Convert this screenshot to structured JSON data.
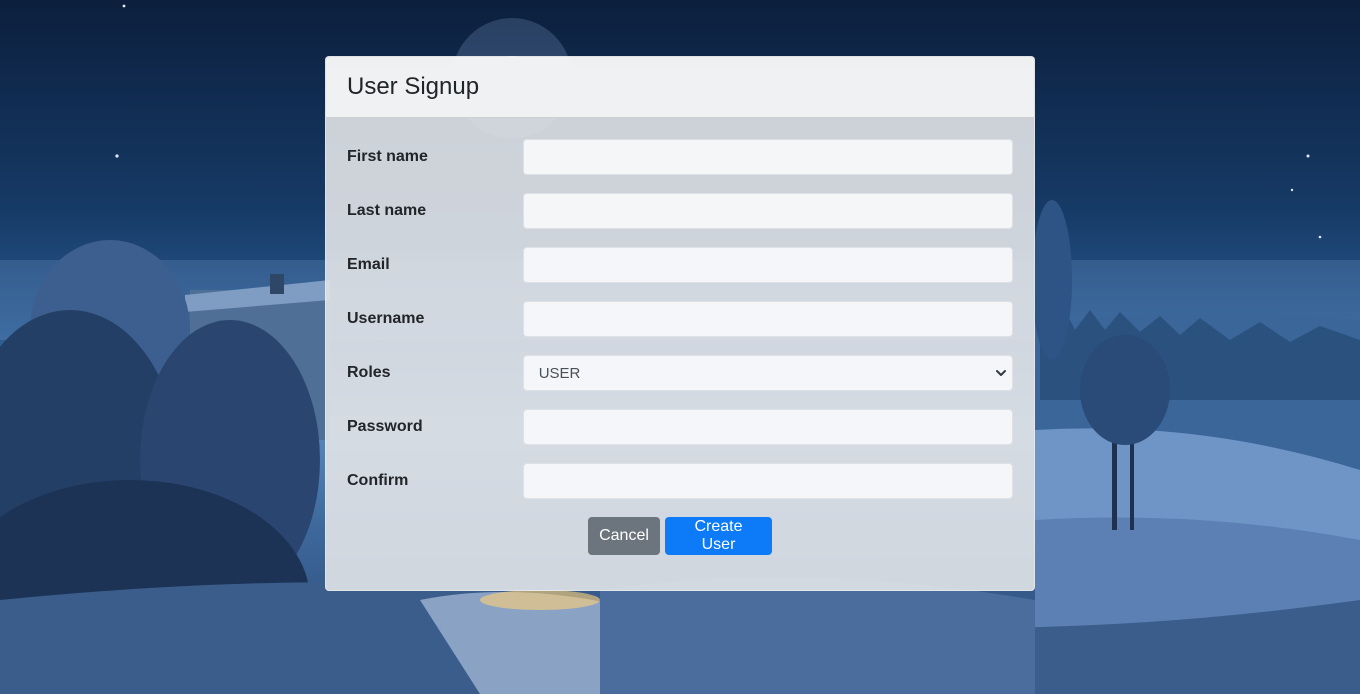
{
  "form": {
    "title": "User Signup",
    "fields": {
      "first_name": {
        "label": "First name",
        "value": ""
      },
      "last_name": {
        "label": "Last name",
        "value": ""
      },
      "email": {
        "label": "Email",
        "value": ""
      },
      "username": {
        "label": "Username",
        "value": ""
      },
      "roles": {
        "label": "Roles",
        "selected": "USER"
      },
      "password": {
        "label": "Password",
        "value": ""
      },
      "confirm": {
        "label": "Confirm",
        "value": ""
      }
    },
    "buttons": {
      "cancel_label": "Cancel",
      "create_label": "Create User"
    }
  },
  "icons": {
    "select_chevron": "chevron-down-icon"
  },
  "colors": {
    "primary": "#0d7bf8",
    "secondary": "#6c757d"
  }
}
